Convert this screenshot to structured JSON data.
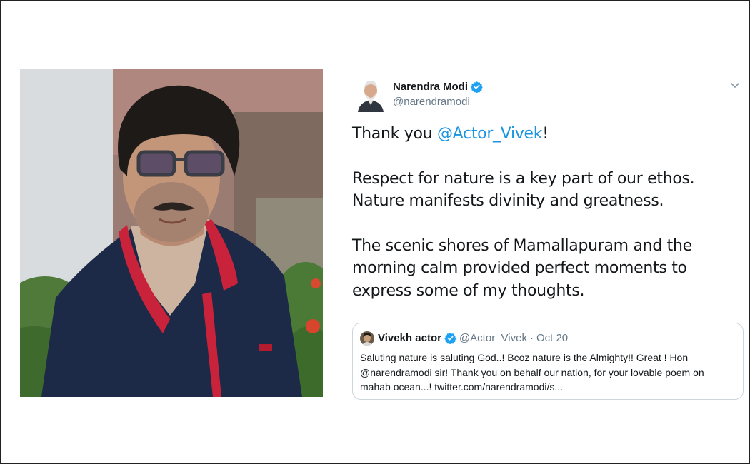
{
  "tweet": {
    "author": {
      "name": "Narendra Modi",
      "handle": "@narendramodi",
      "verified": true
    },
    "body": {
      "line1_prefix": "Thank you ",
      "line1_mention": "@Actor_Vivek",
      "line1_suffix": "!",
      "paragraph2": "Respect for nature is a key part of our ethos. Nature manifests divinity and greatness.",
      "paragraph3": "The scenic shores of Mamallapuram and the morning calm provided perfect moments to express some of my thoughts."
    },
    "quoted": {
      "name": "Vivekh actor",
      "handle": "@Actor_Vivek",
      "separator": "·",
      "date": "Oct 20",
      "text": "Saluting nature is saluting God..! Bcoz nature is the Almighty!! Great ! Hon @narendramodi sir! Thank you on behalf our nation, for your lovable poem on mahab ocean...! twitter.com/narendramodi/s..."
    }
  },
  "icons": {
    "verified": "verified-badge-icon",
    "more": "chevron-down-icon"
  },
  "colors": {
    "mention": "#1b95e0",
    "verified": "#1da1f2",
    "secondary_text": "#657786",
    "border": "#ccd6dd"
  }
}
